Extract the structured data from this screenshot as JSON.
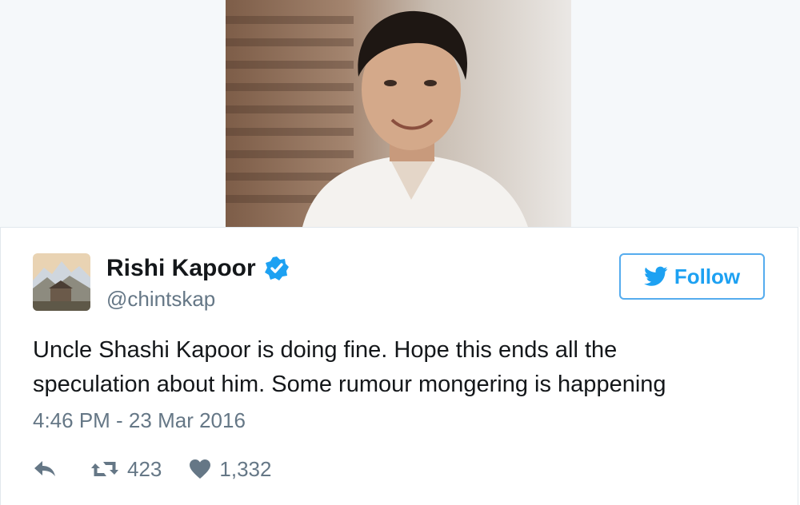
{
  "media": {
    "alt": ""
  },
  "author": {
    "display_name": "Rishi Kapoor",
    "handle": "@chintskap",
    "verified": true
  },
  "follow": {
    "label": "Follow"
  },
  "tweet": {
    "text_line1": "Uncle Shashi Kapoor is doing fine. Hope this ends all the",
    "text_line2": "speculation about him. Some rumour mongering is happening",
    "timestamp": "4:46 PM - 23 Mar 2016"
  },
  "stats": {
    "retweets": "423",
    "likes": "1,332"
  },
  "colors": {
    "brand_blue": "#1da1f2",
    "muted_text": "#657786",
    "border": "#e1e8ed"
  },
  "icons": [
    "verified-badge-icon",
    "twitter-bird-icon",
    "reply-icon",
    "retweet-icon",
    "heart-icon"
  ]
}
